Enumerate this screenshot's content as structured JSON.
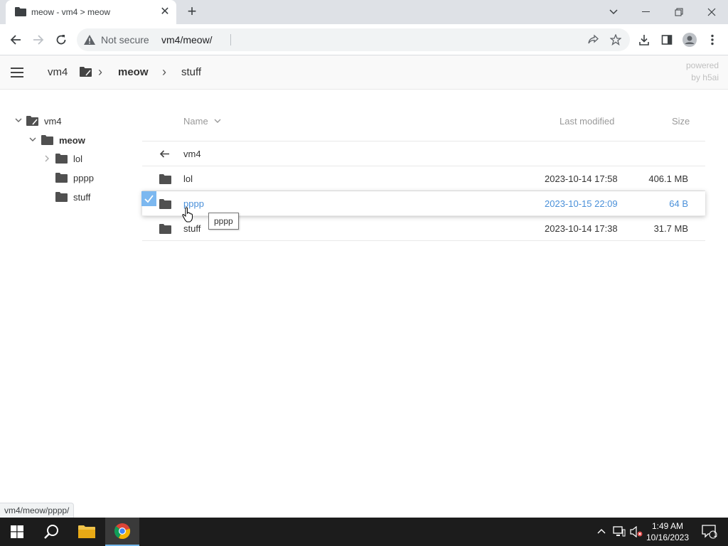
{
  "browser": {
    "tab_title": "meow - vm4 > meow",
    "security_label": "Not secure",
    "url": "vm4/meow/",
    "status_url": "vm4/meow/pppp/"
  },
  "header": {
    "crumbs": [
      "vm4",
      "meow",
      "stuff"
    ],
    "powered_line1": "powered",
    "powered_line2": "by h5ai"
  },
  "tree": {
    "root": "vm4",
    "current": "meow",
    "children": [
      "lol",
      "pppp",
      "stuff"
    ]
  },
  "list": {
    "col_name": "Name",
    "col_modified": "Last modified",
    "col_size": "Size",
    "parent_label": "vm4",
    "rows": [
      {
        "name": "lol",
        "modified": "2023-10-14 17:58",
        "size": "406.1 MB"
      },
      {
        "name": "pppp",
        "modified": "2023-10-15 22:09",
        "size": "64 B"
      },
      {
        "name": "stuff",
        "modified": "2023-10-14 17:38",
        "size": "31.7 MB"
      }
    ],
    "tooltip": "pppp"
  },
  "taskbar": {
    "time": "1:49 AM",
    "date": "10/16/2023",
    "notification_count": "1"
  },
  "colors": {
    "selected_text": "#4a90d9",
    "checkbox": "#7cb8f0"
  }
}
